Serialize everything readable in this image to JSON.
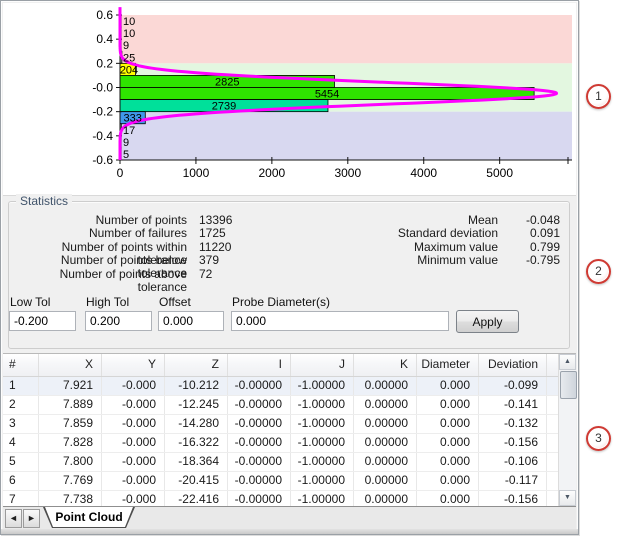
{
  "chart_data": {
    "type": "bar",
    "orientation": "horizontal",
    "title": "",
    "xlabel": "",
    "ylabel": "",
    "x_ticks": [
      0,
      1000,
      2000,
      3000,
      4000,
      5000
    ],
    "x_max": 5900,
    "y_min": -0.6,
    "y_max": 0.6,
    "y_ticks": [
      {
        "label": "0.6",
        "v": 0.6
      },
      {
        "label": "0.4",
        "v": 0.4
      },
      {
        "label": "0.2",
        "v": 0.2
      },
      {
        "label": "-0.0",
        "v": 0.0
      },
      {
        "label": "-0.2",
        "v": -0.2
      },
      {
        "label": "-0.4",
        "v": -0.4
      },
      {
        "label": "-0.6",
        "v": -0.6
      }
    ],
    "tolerance_zones": [
      {
        "name": "above-tolerance",
        "from": 0.2,
        "to": 0.6,
        "color": "#fbd8d6"
      },
      {
        "name": "within-tolerance",
        "from": -0.2,
        "to": 0.2,
        "color": "#e3f7e0"
      },
      {
        "name": "below-tolerance",
        "from": -0.6,
        "to": -0.2,
        "color": "#d8d8f0"
      }
    ],
    "bins": [
      {
        "from": 0.5,
        "to": 0.6,
        "count": 10,
        "color": "#9b9b9b",
        "label_inside": false
      },
      {
        "from": 0.4,
        "to": 0.5,
        "count": 10,
        "color": "#9b9b9b",
        "label_inside": false
      },
      {
        "from": 0.3,
        "to": 0.4,
        "count": 9,
        "color": "#9b9b9b",
        "label_inside": false
      },
      {
        "from": 0.2,
        "to": 0.3,
        "count": 25,
        "color": "#9b9b9b",
        "label_inside": false
      },
      {
        "from": 0.1,
        "to": 0.2,
        "count": 204,
        "color": "#ffff00",
        "label_inside": true
      },
      {
        "from": 0.0,
        "to": 0.1,
        "count": 2825,
        "color": "#2fe400",
        "label_inside": true
      },
      {
        "from": -0.1,
        "to": 0.0,
        "count": 5454,
        "color": "#2fe400",
        "label_inside": true
      },
      {
        "from": -0.2,
        "to": -0.1,
        "count": 2739,
        "color": "#00e09a",
        "label_inside": true
      },
      {
        "from": -0.3,
        "to": -0.2,
        "count": 333,
        "color": "#3f97ea",
        "label_inside": true
      },
      {
        "from": -0.4,
        "to": -0.3,
        "count": 17,
        "color": "#9b9b9b",
        "label_inside": false
      },
      {
        "from": -0.5,
        "to": -0.4,
        "count": 9,
        "color": "#9b9b9b",
        "label_inside": false
      },
      {
        "from": -0.6,
        "to": -0.5,
        "count": 5,
        "color": "#9b9b9b",
        "label_inside": false
      }
    ],
    "gauss_fit": {
      "mean": -0.048,
      "std": 0.091,
      "peak": 5750,
      "color": "#ff00ff"
    }
  },
  "statistics": {
    "title": "Statistics",
    "left": [
      {
        "label": "Number of points",
        "value": "13396"
      },
      {
        "label": "Number of failures",
        "value": "1725"
      },
      {
        "label": "Number of points within tolerance",
        "value": "11220"
      },
      {
        "label": "Number of points below tolerance",
        "value": "379"
      },
      {
        "label": "Number of points above tolerance",
        "value": "72"
      }
    ],
    "right": [
      {
        "label": "Mean",
        "value": "-0.048"
      },
      {
        "label": "Standard deviation",
        "value": "0.091"
      },
      {
        "label": "Maximum value",
        "value": "0.799"
      },
      {
        "label": "Minimum value",
        "value": "-0.795"
      }
    ]
  },
  "controls": {
    "fields": [
      {
        "name": "low-tol",
        "label": "Low Tol",
        "value": "-0.200"
      },
      {
        "name": "high-tol",
        "label": "High Tol",
        "value": "0.200"
      },
      {
        "name": "offset",
        "label": "Offset",
        "value": "0.000"
      },
      {
        "name": "probe-diameter",
        "label": "Probe Diameter(s)",
        "value": "0.000"
      }
    ],
    "apply_label": "Apply"
  },
  "table": {
    "headers": [
      "#",
      "X",
      "Y",
      "Z",
      "I",
      "J",
      "K",
      "Diameter",
      "Deviation"
    ],
    "rows": [
      [
        "1",
        "7.921",
        "-0.000",
        "-10.212",
        "-0.00000",
        "-1.00000",
        "0.00000",
        "0.000",
        "-0.099"
      ],
      [
        "2",
        "7.889",
        "-0.000",
        "-12.245",
        "-0.00000",
        "-1.00000",
        "0.00000",
        "0.000",
        "-0.141"
      ],
      [
        "3",
        "7.859",
        "-0.000",
        "-14.280",
        "-0.00000",
        "-1.00000",
        "0.00000",
        "0.000",
        "-0.132"
      ],
      [
        "4",
        "7.828",
        "-0.000",
        "-16.322",
        "-0.00000",
        "-1.00000",
        "0.00000",
        "0.000",
        "-0.156"
      ],
      [
        "5",
        "7.800",
        "-0.000",
        "-18.364",
        "-0.00000",
        "-1.00000",
        "0.00000",
        "0.000",
        "-0.106"
      ],
      [
        "6",
        "7.769",
        "-0.000",
        "-20.415",
        "-0.00000",
        "-1.00000",
        "0.00000",
        "0.000",
        "-0.117"
      ],
      [
        "7",
        "7.738",
        "-0.000",
        "-22.416",
        "-0.00000",
        "-1.00000",
        "0.00000",
        "0.000",
        "-0.156"
      ]
    ]
  },
  "tab_bar": {
    "active_tab": "Point Cloud"
  },
  "annotations": [
    "1",
    "2",
    "3"
  ]
}
